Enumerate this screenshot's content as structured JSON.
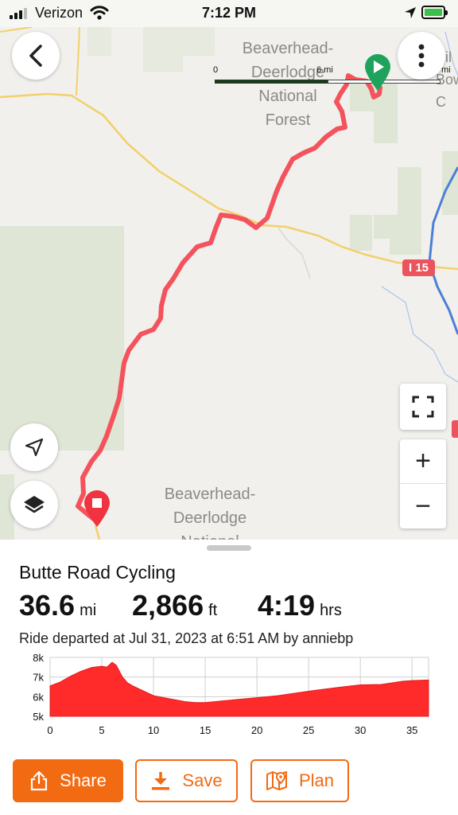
{
  "status_bar": {
    "carrier": "Verizon",
    "time": "7:12 PM",
    "icons": [
      "signal-icon",
      "wifi-icon",
      "location-arrow-icon",
      "battery-charging-icon"
    ],
    "battery_color": "#3bc14a"
  },
  "map": {
    "labels": {
      "forest_north": "Beaverhead-\nDeerlodge\nNational\nForest",
      "forest_south": "Beaverhead-\nDeerlodge\nNational",
      "partial_right": "Sil\nBow C"
    },
    "scale": {
      "start": "0",
      "mid": "6 mi",
      "end": "mi"
    },
    "highway_shield": "I 15",
    "route_color": "#f4525c",
    "start_marker_color": "#1fa35c",
    "end_marker_color": "#ef3340",
    "buttons": {
      "back": "back-icon",
      "more": "more-vertical-icon",
      "locate": "navigation-arrow-icon",
      "layers": "layers-icon",
      "fullscreen": "fullscreen-icon",
      "zoom_in": "+",
      "zoom_out": "−"
    }
  },
  "ride": {
    "title": "Butte Road Cycling",
    "distance_value": "36.6",
    "distance_unit": "mi",
    "elevation_value": "2,866",
    "elevation_unit": "ft",
    "time_value": "4:19",
    "time_unit": "hrs",
    "subtitle": "Ride departed at Jul 31, 2023 at 6:51 AM by anniebp"
  },
  "chart_data": {
    "type": "area",
    "title": "",
    "xlabel": "",
    "ylabel": "",
    "x_ticks": [
      0,
      5,
      10,
      15,
      20,
      25,
      30,
      35
    ],
    "y_ticks": [
      "5k",
      "6k",
      "7k",
      "8k"
    ],
    "xlim": [
      0,
      36.6
    ],
    "ylim": [
      5000,
      8000
    ],
    "grid": true,
    "color": "#ff2a2a",
    "x": [
      0,
      1,
      2,
      3,
      4,
      5,
      5.5,
      6,
      6.4,
      7,
      7.5,
      8,
      9,
      10,
      11,
      12,
      13,
      14,
      15,
      16,
      18,
      20,
      22,
      24,
      26,
      28,
      30,
      32,
      33,
      34,
      35,
      36.6
    ],
    "y": [
      6550,
      6750,
      7050,
      7300,
      7480,
      7550,
      7500,
      7750,
      7600,
      7000,
      6700,
      6550,
      6300,
      6050,
      5950,
      5850,
      5750,
      5700,
      5700,
      5750,
      5850,
      5950,
      6050,
      6200,
      6350,
      6480,
      6600,
      6620,
      6700,
      6780,
      6820,
      6850
    ]
  },
  "actions": {
    "share": "Share",
    "save": "Save",
    "plan": "Plan",
    "accent": "#f26a12"
  }
}
